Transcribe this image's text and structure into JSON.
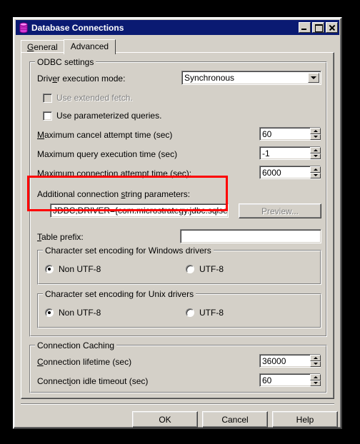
{
  "window": {
    "title": "Database Connections",
    "icon": "database-icon",
    "controls": {
      "minimize": "minimize-button",
      "maximize": "maximize-button",
      "close": "close-button"
    }
  },
  "tabs": [
    {
      "label": "General",
      "active": false
    },
    {
      "label": "Advanced",
      "active": true
    }
  ],
  "odbc": {
    "legend": "ODBC settings",
    "driver_execution_mode_label": "Driver execution mode:",
    "driver_execution_mode_value": "Synchronous",
    "driver_execution_mode_options": [
      "Synchronous"
    ],
    "use_extended_fetch_label": "Use extended fetch.",
    "use_extended_fetch_checked": false,
    "use_extended_fetch_enabled": false,
    "use_parameterized_queries_label": "Use parameterized queries.",
    "use_parameterized_queries_checked": false,
    "max_cancel_attempt_label": "Maximum cancel attempt time (sec)",
    "max_cancel_attempt_value": "60",
    "max_query_execution_label": "Maximum query execution time (sec)",
    "max_query_execution_value": "-1",
    "max_connection_attempt_label": "Maximum connection attempt time (sec):",
    "max_connection_attempt_value": "6000",
    "additional_params_label": "Additional connection string parameters:",
    "additional_params_value": "JDBC;DRIVER={com.microstrategy.jdbc.sqlserv",
    "preview_label": "Preview...",
    "preview_enabled": false,
    "table_prefix_label": "Table prefix:",
    "table_prefix_value": "",
    "windows_encoding": {
      "legend": "Character set encoding for Windows drivers",
      "options": [
        {
          "label": "Non UTF-8",
          "selected": true
        },
        {
          "label": "UTF-8",
          "selected": false
        }
      ]
    },
    "unix_encoding": {
      "legend": "Character set encoding for Unix drivers",
      "options": [
        {
          "label": "Non UTF-8",
          "selected": true
        },
        {
          "label": "UTF-8",
          "selected": false
        }
      ]
    }
  },
  "connection_caching": {
    "legend": "Connection Caching",
    "lifetime_label": "Connection lifetime (sec)",
    "lifetime_value": "36000",
    "idle_timeout_label": "Connection idle timeout (sec)",
    "idle_timeout_value": "60"
  },
  "footer": {
    "ok_label": "OK",
    "cancel_label": "Cancel",
    "help_label": "Help"
  },
  "annotation": {
    "highlight_color": "#ff0000",
    "target": "additional-connection-string-parameters"
  },
  "colors": {
    "titlebar": "#0a1a72",
    "face": "#d4d0c8",
    "field": "#ffffff",
    "disabled_text": "#808080",
    "backdrop": "#000000"
  }
}
